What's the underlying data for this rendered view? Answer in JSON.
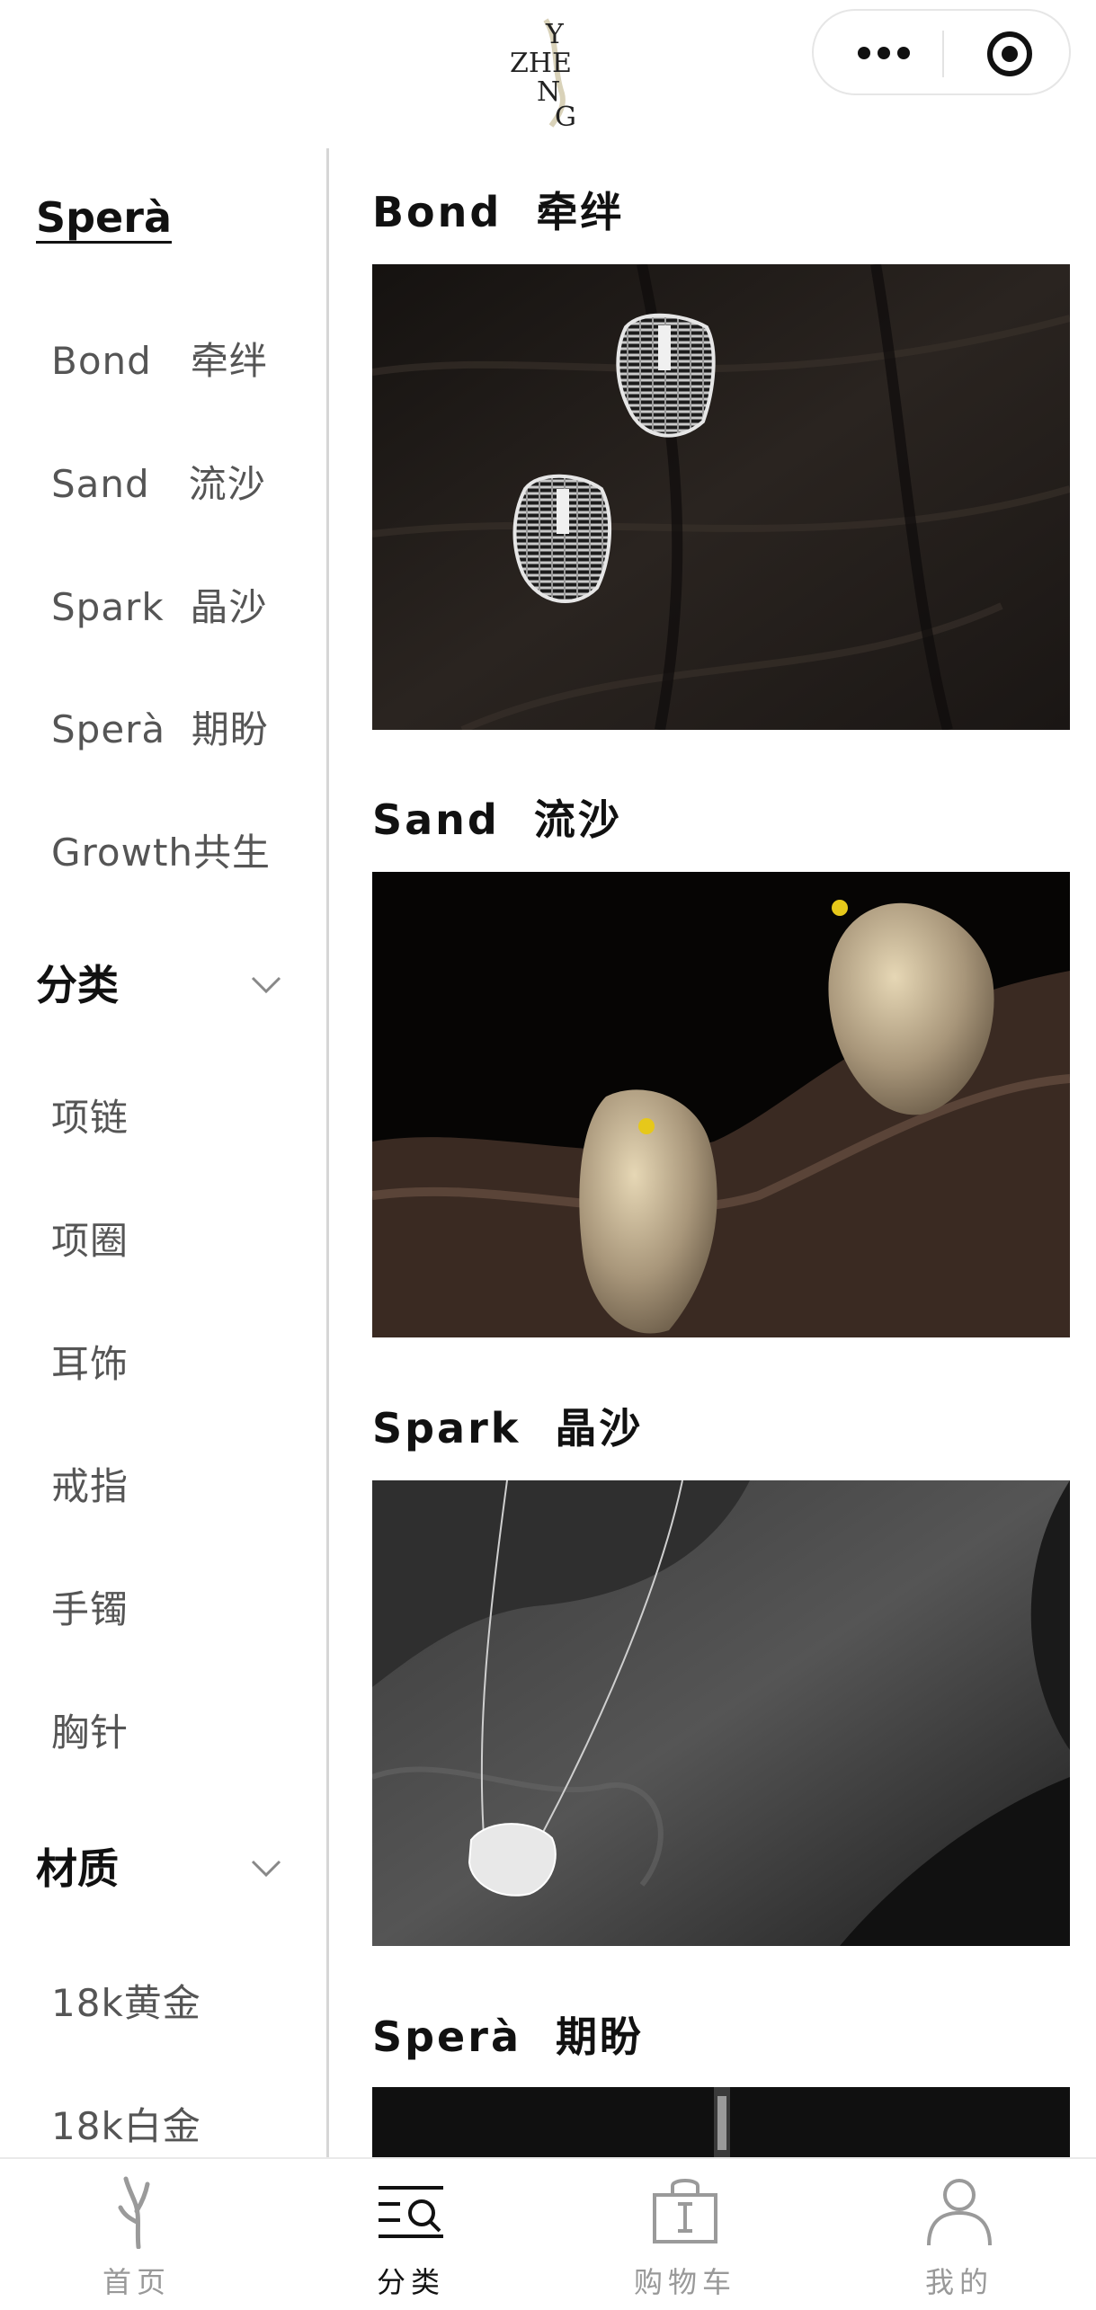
{
  "header": {
    "logo_text": [
      "Y",
      "ZHE",
      "N",
      "G"
    ],
    "more_icon": "more-dots-icon",
    "close_icon": "target-circle-icon"
  },
  "sidebar": {
    "collection_heading": "Sperà",
    "collections": [
      "Bond   牵绊",
      "Sand   流沙",
      "Spark  晶沙",
      "Sperà  期盼",
      "Growth共生"
    ],
    "category_heading": "分类",
    "categories": [
      "项链",
      "项圈",
      "耳饰",
      "戒指",
      "手镯",
      "胸针"
    ],
    "material_heading": "材质",
    "materials": [
      "18k黄金",
      "18k白金"
    ]
  },
  "sections": [
    {
      "title": "Bond  牵绊"
    },
    {
      "title": "Sand  流沙"
    },
    {
      "title": "Spark  晶沙"
    },
    {
      "title": "Sperà  期盼"
    }
  ],
  "tabbar": {
    "tabs": [
      {
        "label": "首页",
        "icon": "coral-home-icon"
      },
      {
        "label": "分类",
        "icon": "category-search-icon"
      },
      {
        "label": "购物车",
        "icon": "shopping-bag-icon"
      },
      {
        "label": "我的",
        "icon": "user-profile-icon"
      }
    ],
    "active_index": 1
  }
}
